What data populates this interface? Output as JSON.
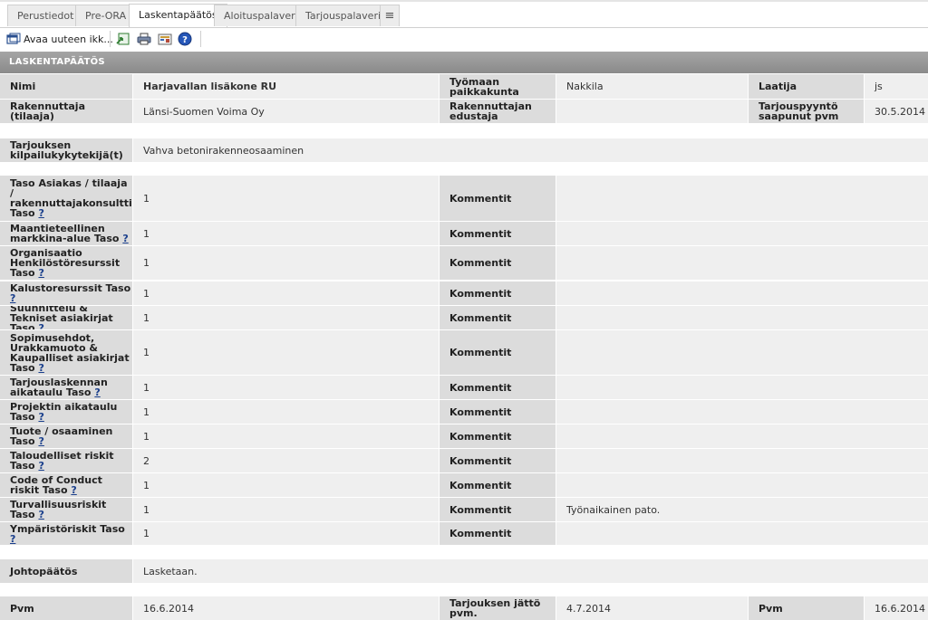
{
  "tabs": [
    {
      "label": "Perustiedot"
    },
    {
      "label": "Pre-ORA"
    },
    {
      "label": "Laskentapäätös"
    },
    {
      "label": "Aloituspalaveri"
    },
    {
      "label": "Tarjouspalaveri"
    }
  ],
  "tab_more_glyph": "≡",
  "toolbar": {
    "open_label": "Avaa uuteen ikk...",
    "help_glyph": "?"
  },
  "section": {
    "title": "LASKENTAPÄÄTÖS"
  },
  "header_rows": {
    "nimi_label": "Nimi",
    "nimi_value": "Harjavallan lisäkone RU",
    "tyomaa_label": "Työmaan paikkakunta",
    "tyomaa_value": "Nakkila",
    "laatija_label": "Laatija",
    "laatija_value": "js",
    "rakennuttaja_label": "Rakennuttaja (tilaaja)",
    "rakennuttaja_value": "Länsi-Suomen Voima Oy",
    "edustaja_label": "Rakennuttajan edustaja",
    "edustaja_value": "",
    "saapunut_label": "Tarjouspyyntö saapunut pvm",
    "saapunut_value": "30.5.2014"
  },
  "kilpailu": {
    "label": "Tarjouksen kilpailukykytekijä(t)",
    "value": "Vahva betonirakenneosaaminen"
  },
  "help_mark": "?",
  "comment_label": "Kommentit",
  "levels": [
    {
      "label": "Taso Asiakas / tilaaja / rakennuttajakonsultti Taso",
      "value": "1",
      "comment": ""
    },
    {
      "label": "Maantieteellinen markkina-alue Taso",
      "value": "1",
      "comment": ""
    },
    {
      "label": "Organisaatio Henkilöstöresurssit Taso",
      "value": "1",
      "comment": ""
    },
    {
      "label": "Kalustoresurssit Taso",
      "value": "1",
      "comment": ""
    },
    {
      "label": "Suunnittelu & Tekniset asiakirjat Taso",
      "value": "1",
      "comment": ""
    },
    {
      "label": "Sopimusehdot, Urakkamuoto & Kaupalliset asiakirjat Taso",
      "value": "1",
      "comment": ""
    },
    {
      "label": "Tarjouslaskennan aikataulu Taso",
      "value": "1",
      "comment": ""
    },
    {
      "label": "Projektin aikataulu Taso",
      "value": "1",
      "comment": ""
    },
    {
      "label": "Tuote / osaaminen Taso",
      "value": "1",
      "comment": ""
    },
    {
      "label": "Taloudelliset riskit Taso",
      "value": "2",
      "comment": ""
    },
    {
      "label": "Code of Conduct riskit Taso",
      "value": "1",
      "comment": ""
    },
    {
      "label": "Turvallisuusriskit Taso",
      "value": "1",
      "comment": "Työnaikainen pato."
    },
    {
      "label": "Ympäristöriskit Taso",
      "value": "1",
      "comment": ""
    }
  ],
  "johtopaatos": {
    "label": "Johtopäätös",
    "value": "Lasketaan."
  },
  "footer_row": {
    "pvm_label": "Pvm",
    "pvm_value": "16.6.2014",
    "jatto_label": "Tarjouksen jättö pvm.",
    "jatto_value": "4.7.2014",
    "pvm2_label": "Pvm",
    "pvm2_value": "16.6.2014"
  },
  "colors": {
    "label_bg": "#dcdcdc",
    "value_bg": "#efefef",
    "header_bg": "#8a8a8a",
    "link": "#1a3f8c"
  }
}
